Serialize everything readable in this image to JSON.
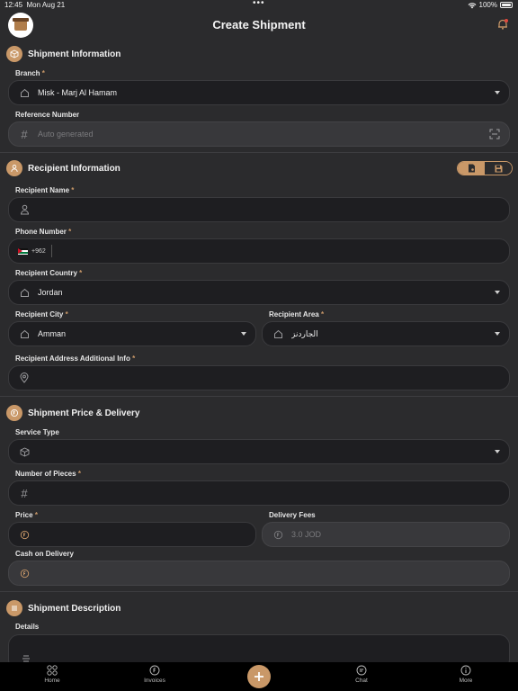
{
  "status": {
    "time": "12:45",
    "date": "Mon Aug 21",
    "dots": "•••",
    "battery": "100%"
  },
  "header": {
    "title": "Create Shipment"
  },
  "sections": {
    "shipment_info": {
      "title": "Shipment Information"
    },
    "recipient_info": {
      "title": "Recipient Information"
    },
    "price_delivery": {
      "title": "Shipment Price & Delivery"
    },
    "description": {
      "title": "Shipment Description"
    }
  },
  "fields": {
    "branch": {
      "label": "Branch",
      "value": "Misk - Marj Al Hamam"
    },
    "reference": {
      "label": "Reference Number",
      "placeholder": "Auto generated"
    },
    "recipient_name": {
      "label": "Recipient Name",
      "value": ""
    },
    "phone": {
      "label": "Phone Number",
      "prefix": "+962",
      "value": ""
    },
    "country": {
      "label": "Recipient Country",
      "value": "Jordan"
    },
    "city": {
      "label": "Recipient City",
      "value": "Amman"
    },
    "area": {
      "label": "Recipient Area",
      "value": "الجاردنز"
    },
    "address": {
      "label": "Recipient Address Additional Info",
      "value": ""
    },
    "service_type": {
      "label": "Service Type",
      "value": ""
    },
    "pieces": {
      "label": "Number of Pieces",
      "value": ""
    },
    "price": {
      "label": "Price",
      "value": ""
    },
    "delivery_fees": {
      "label": "Delivery Fees",
      "value": "3.0 JOD"
    },
    "cod": {
      "label": "Cash on Delivery",
      "value": ""
    },
    "details": {
      "label": "Details",
      "value": ""
    }
  },
  "required_mark": "*",
  "tabs": [
    {
      "label": "Home",
      "icon": "grid-icon"
    },
    {
      "label": "Invoices",
      "icon": "invoice-icon"
    },
    {
      "label": "",
      "icon": "plus-icon"
    },
    {
      "label": "Chat",
      "icon": "chat-icon"
    },
    {
      "label": "More",
      "icon": "info-icon"
    }
  ],
  "colors": {
    "accent": "#c99868",
    "background": "#2b2b2d",
    "field": "#1e1e21",
    "tabbar": "#000000"
  }
}
